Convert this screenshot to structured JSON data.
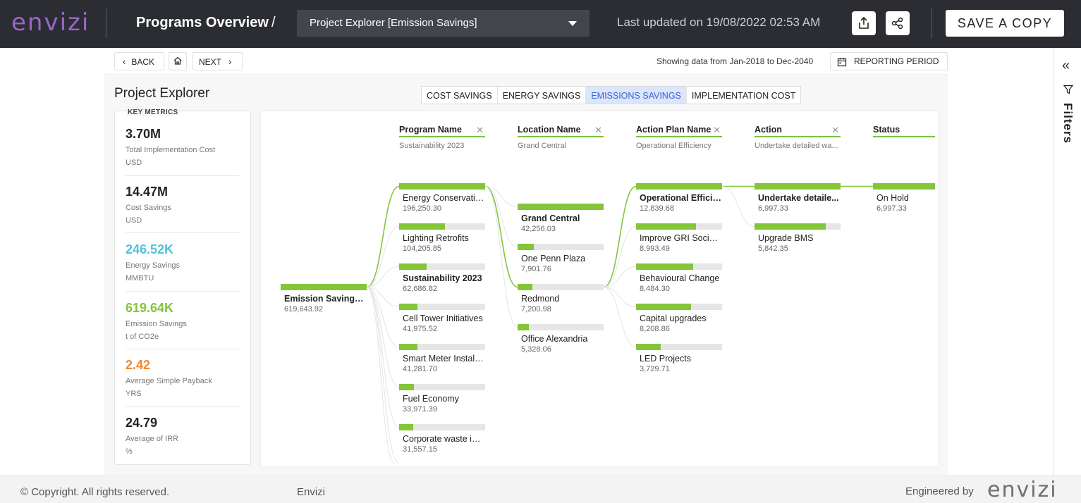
{
  "header": {
    "logo": "envizi",
    "title": "Programs Overview",
    "separator": "/",
    "view_select": "Project Explorer [Emission Savings]",
    "last_updated": "Last updated on 19/08/2022 02:53 AM",
    "save_label": "SAVE A COPY"
  },
  "nav": {
    "back": "BACK",
    "next": "NEXT",
    "showing": "Showing data from Jan-2018 to Dec-2040",
    "reporting_period": "REPORTING PERIOD"
  },
  "rail": {
    "filters_label": "Filters"
  },
  "page": {
    "title": "Project Explorer",
    "tabs": [
      {
        "label": "COST SAVINGS",
        "active": false
      },
      {
        "label": "ENERGY SAVINGS",
        "active": false
      },
      {
        "label": "EMISSIONS SAVINGS",
        "active": true
      },
      {
        "label": "IMPLEMENTATION COST",
        "active": false
      }
    ]
  },
  "metrics": {
    "header": "KEY METRICS",
    "items": [
      {
        "value": "3.70M",
        "label": "Total Implementation Cost",
        "unit": "USD",
        "color": "#222222"
      },
      {
        "value": "14.47M",
        "label": "Cost Savings",
        "unit": "USD",
        "color": "#222222"
      },
      {
        "value": "246.52K",
        "label": "Energy Savings",
        "unit": "MMBTU",
        "color": "#4fc3d9"
      },
      {
        "value": "619.64K",
        "label": "Emission Savings",
        "unit": "t of CO2e",
        "color": "#84c53a"
      },
      {
        "value": "2.42",
        "label": "Average Simple Payback",
        "unit": "YRS",
        "color": "#ef8a2f"
      },
      {
        "value": "24.79",
        "label": "Average of IRR",
        "unit": "%",
        "color": "#222222"
      }
    ]
  },
  "tree": {
    "accent": "#84c53a",
    "columns": [
      {
        "name": "Program Name",
        "sub": "Sustainability 2023",
        "closable": true
      },
      {
        "name": "Location Name",
        "sub": "Grand Central",
        "closable": true
      },
      {
        "name": "Action Plan Name",
        "sub": "Operational Efficiency",
        "closable": true
      },
      {
        "name": "Action",
        "sub": "Undertake detailed wa...",
        "closable": true
      },
      {
        "name": "Status",
        "sub": "",
        "closable": false
      }
    ],
    "root": {
      "label": "Emission Savings i...",
      "value": "619,643.92",
      "fill": 1.0
    },
    "levels": [
      [
        {
          "label": "Energy Conservatio...",
          "value": "196,250.30",
          "fill": 1.0,
          "bold": false
        },
        {
          "label": "Lighting Retrofits",
          "value": "104,205.85",
          "fill": 0.53,
          "bold": false
        },
        {
          "label": "Sustainability 2023",
          "value": "62,686.82",
          "fill": 0.32,
          "bold": true
        },
        {
          "label": "Cell Tower Initiatives",
          "value": "41,975.52",
          "fill": 0.21,
          "bold": false
        },
        {
          "label": "Smart Meter Installa...",
          "value": "41,281.70",
          "fill": 0.21,
          "bold": false
        },
        {
          "label": "Fuel Economy",
          "value": "33,971.39",
          "fill": 0.17,
          "bold": false
        },
        {
          "label": "Corporate waste init...",
          "value": "31,557.15",
          "fill": 0.16,
          "bold": false
        }
      ],
      [
        {
          "label": "Grand Central",
          "value": "42,256.03",
          "fill": 1.0,
          "bold": true
        },
        {
          "label": "One Penn Plaza",
          "value": "7,901.76",
          "fill": 0.19,
          "bold": false
        },
        {
          "label": "Redmond",
          "value": "7,200.98",
          "fill": 0.17,
          "bold": false
        },
        {
          "label": "Office Alexandria",
          "value": "5,328.06",
          "fill": 0.13,
          "bold": false
        }
      ],
      [
        {
          "label": "Operational Efficie...",
          "value": "12,839.68",
          "fill": 1.0,
          "bold": true
        },
        {
          "label": "Improve GRI Social ...",
          "value": "8,993.49",
          "fill": 0.7,
          "bold": false
        },
        {
          "label": "Behavioural Change",
          "value": "8,484.30",
          "fill": 0.66,
          "bold": false
        },
        {
          "label": "Capital upgrades",
          "value": "8,208.86",
          "fill": 0.64,
          "bold": false
        },
        {
          "label": "LED Projects",
          "value": "3,729.71",
          "fill": 0.29,
          "bold": false
        }
      ],
      [
        {
          "label": "Undertake detaile...",
          "value": "6,997.33",
          "fill": 1.0,
          "bold": true
        },
        {
          "label": "Upgrade BMS",
          "value": "5,842.35",
          "fill": 0.83,
          "bold": false
        }
      ],
      [
        {
          "label": "On Hold",
          "value": "6,997.33",
          "fill": 1.0,
          "bold": false
        }
      ]
    ]
  },
  "footer": {
    "copyright": "© Copyright. All rights reserved.",
    "brand": "Envizi",
    "engineered": "Engineered by",
    "logo": "envizi"
  }
}
